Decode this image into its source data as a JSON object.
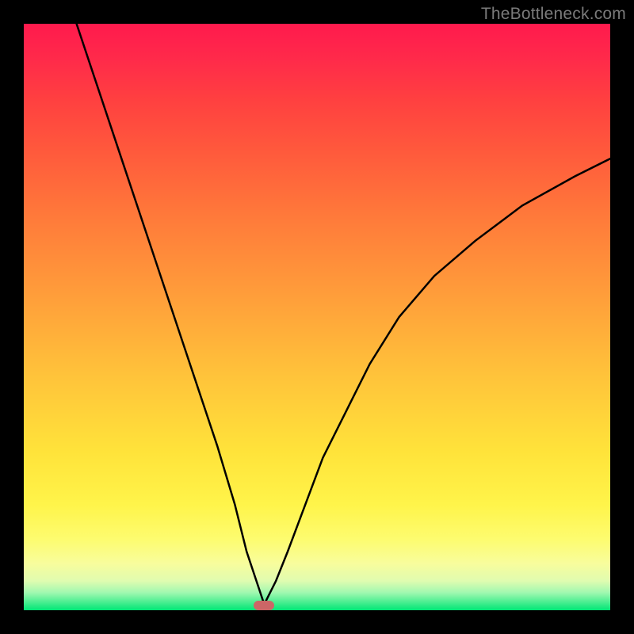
{
  "watermark": "TheBottleneck.com",
  "chart_data": {
    "type": "line",
    "title": "",
    "xlabel": "",
    "ylabel": "",
    "xlim": [
      0,
      100
    ],
    "ylim": [
      0,
      100
    ],
    "grid": false,
    "legend": false,
    "marker": {
      "x_percent": 41,
      "y_percent": 99,
      "color": "#cc6666"
    },
    "gradient_stops": [
      {
        "pos": 0,
        "color": "#ff1a4d"
      },
      {
        "pos": 45,
        "color": "#ff9a3a"
      },
      {
        "pos": 73,
        "color": "#ffe33a"
      },
      {
        "pos": 100,
        "color": "#00e676"
      }
    ],
    "series": [
      {
        "name": "left-branch",
        "x": [
          9,
          12,
          15,
          18,
          21,
          24,
          27,
          30,
          33,
          36,
          38,
          40,
          41
        ],
        "y": [
          100,
          91,
          82,
          73,
          64,
          55,
          46,
          37,
          28,
          18,
          10,
          4,
          1
        ]
      },
      {
        "name": "right-branch",
        "x": [
          41,
          43,
          45,
          48,
          51,
          55,
          59,
          64,
          70,
          77,
          85,
          94,
          100
        ],
        "y": [
          1,
          5,
          10,
          18,
          26,
          34,
          42,
          50,
          57,
          63,
          69,
          74,
          77
        ]
      }
    ]
  }
}
